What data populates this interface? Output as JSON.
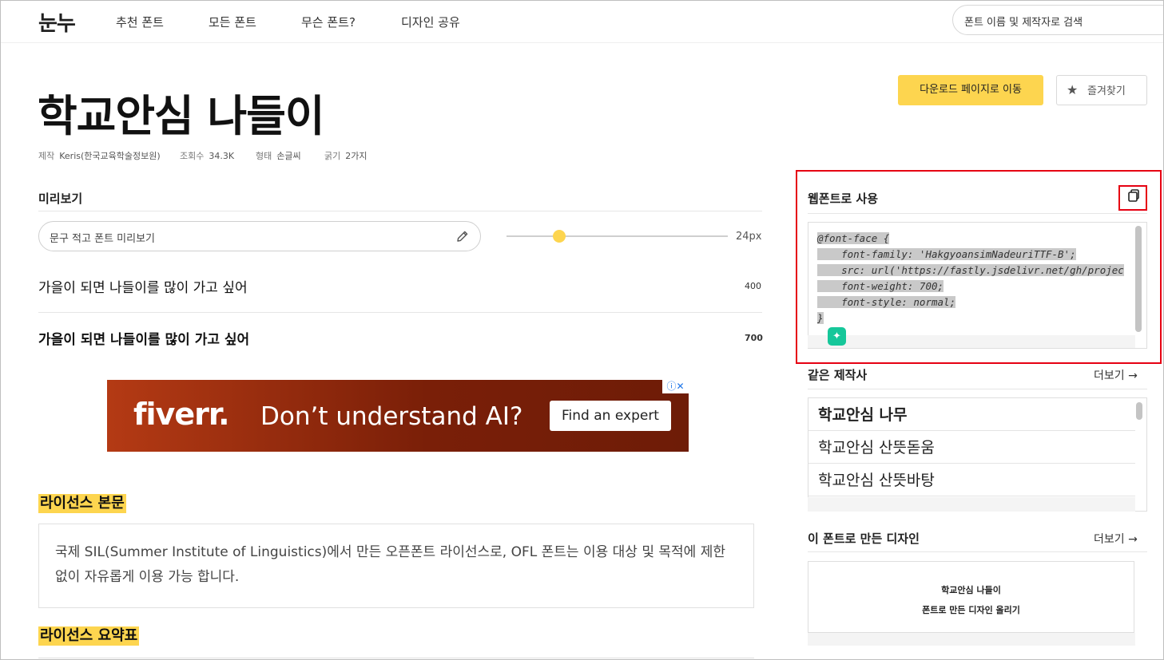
{
  "nav": {
    "logo": "눈누",
    "items": [
      "추천 폰트",
      "모든 폰트",
      "무슨 폰트?",
      "디자인 공유"
    ],
    "search_placeholder": "폰트 이름 및 제작자로 검색"
  },
  "font": {
    "title": "학교안심 나들이",
    "meta": {
      "maker_label": "제작",
      "maker": "Keris(한국교육학술정보원)",
      "views_label": "조회수",
      "views": "34.3K",
      "type_label": "형태",
      "type": "손글씨",
      "weight_label": "굵기",
      "weight": "2가지"
    },
    "download_label": "다운로드 페이지로 이동",
    "favorite_label": "즐겨찾기"
  },
  "preview": {
    "section_label": "미리보기",
    "input_placeholder": "문구 적고 폰트 미리보기",
    "size_value": "24px",
    "size_level": 0.24,
    "samples": [
      {
        "text": "가을이 되면 나들이를 많이 가고 싶어",
        "weight": "400"
      },
      {
        "text": "가을이 되면 나들이를 많이 가고 싶어",
        "weight": "700"
      }
    ]
  },
  "ad": {
    "logo": "fiverr.",
    "text": "Don’t understand AI?",
    "button": "Find an expert",
    "badge": "ⓘ✕"
  },
  "license": {
    "body_heading": "라이선스 본문",
    "body_text": "국제 SIL(Summer Institute of Linguistics)에서 만든 오픈폰트 라이선스로, OFL 폰트는 이용 대상 및 목적에 제한없이 자유롭게 이용 가능 합니다.",
    "summary_heading": "라이선스 요약표"
  },
  "webfont": {
    "title": "웹폰트로 사용",
    "code_lines": [
      "@font-face {",
      "    font-family: 'HakgyoansimNadeuriTTF-B';",
      "    src: url('https://fastly.jsdelivr.net/gh/projec",
      "    font-weight: 700;",
      "    font-style: normal;",
      "}"
    ]
  },
  "same_author": {
    "heading": "같은 제작사",
    "more": "더보기 →",
    "items": [
      "학교안심 나무",
      "학교안심 산뜻돋움",
      "학교안심 산뜻바탕"
    ]
  },
  "designs": {
    "heading": "이 폰트로 만든 디자인",
    "more": "더보기 →",
    "line1": "학교안심 나들이",
    "line2": "폰트로 만든 디자인 올리기"
  },
  "colors": {
    "accent_yellow": "#fdd54f",
    "highlight_red": "#e60012",
    "badge_green": "#16c79a"
  }
}
